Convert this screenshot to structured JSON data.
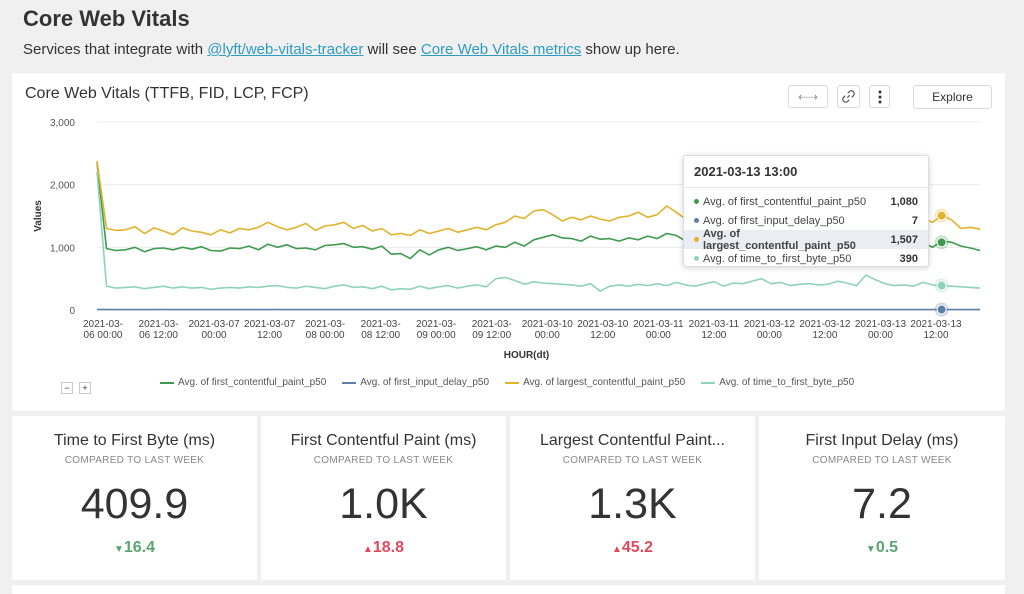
{
  "page": {
    "title": "Core Web Vitals",
    "subtitle_prefix": "Services that integrate with ",
    "subtitle_link1": "@lyft/web-vitals-tracker",
    "subtitle_middle": " will see ",
    "subtitle_link2": "Core Web Vitals metrics",
    "subtitle_suffix": " show up here."
  },
  "chart_card": {
    "title": "Core Web Vitals (TTFB, FID, LCP, FCP)",
    "explore_label": "Explore",
    "zoom_out": "−",
    "zoom_in": "+"
  },
  "tooltip": {
    "title": "2021-03-13 13:00",
    "rows": [
      {
        "name": "Avg. of first_contentful_paint_p50",
        "value": "1,080",
        "color": "#3d9a4f"
      },
      {
        "name": "Avg. of first_input_delay_p50",
        "value": "7",
        "color": "#5b7fa6"
      },
      {
        "name": "Avg. of largest_contentful_paint_p50",
        "value": "1,507",
        "color": "#e3b22b"
      },
      {
        "name": "Avg. of time_to_first_byte_p50",
        "value": "390",
        "color": "#8fd3b8"
      }
    ]
  },
  "chart_data": {
    "type": "line",
    "ylabel": "Values",
    "xlabel": "HOUR(dt)",
    "ylim": [
      0,
      3000
    ],
    "yticks": [
      "0",
      "1,000",
      "2,000",
      "3,000"
    ],
    "xticks": [
      [
        "2021-03-",
        "06 00:00"
      ],
      [
        "2021-03-",
        "06 12:00"
      ],
      [
        "2021-03-07",
        "00:00"
      ],
      [
        "2021-03-07",
        "12:00"
      ],
      [
        "2021-03-",
        "08 00:00"
      ],
      [
        "2021-03-",
        "08 12:00"
      ],
      [
        "2021-03-",
        "09 00:00"
      ],
      [
        "2021-03-",
        "09 12:00"
      ],
      [
        "2021-03-10",
        "00:00"
      ],
      [
        "2021-03-10",
        "12:00"
      ],
      [
        "2021-03-11",
        "00:00"
      ],
      [
        "2021-03-11",
        "12:00"
      ],
      [
        "2021-03-12",
        "00:00"
      ],
      [
        "2021-03-12",
        "12:00"
      ],
      [
        "2021-03-13",
        "00:00"
      ],
      [
        "2021-03-13",
        "12:00"
      ]
    ],
    "x_start": "2021-03-06 00:00",
    "x_step_hours": 3,
    "series": [
      {
        "name": "Avg. of first_contentful_paint_p50",
        "color": "#3d9a4f",
        "values": [
          2350,
          980,
          950,
          960,
          1000,
          930,
          980,
          990,
          960,
          1000,
          970,
          1010,
          950,
          940,
          990,
          980,
          1020,
          960,
          1050,
          1000,
          1040,
          980,
          990,
          960,
          1030,
          1040,
          1060,
          1000,
          1010,
          970,
          1020,
          890,
          900,
          820,
          960,
          880,
          960,
          1000,
          950,
          980,
          1010,
          960,
          1020,
          1000,
          1080,
          1020,
          1120,
          1160,
          1200,
          1150,
          1140,
          1100,
          1180,
          1130,
          1140,
          1100,
          1150,
          1120,
          1180,
          1140,
          1220,
          1190,
          1100,
          1160,
          1120,
          1140,
          1090,
          1160,
          1200,
          1220,
          1140,
          1080,
          1150,
          1100,
          1120,
          1150,
          1090,
          1100,
          1180,
          1110,
          1050,
          1080,
          1000,
          1060,
          1120,
          1080,
          1030,
          1080,
          1000,
          1100,
          1080,
          1020,
          990,
          950
        ]
      },
      {
        "name": "Avg. of first_input_delay_p50",
        "color": "#5b7fa6",
        "values": [
          10,
          7,
          6,
          7,
          7,
          6,
          7,
          8,
          7,
          6,
          7,
          7,
          7,
          7,
          6,
          7,
          7,
          7,
          7,
          8,
          7,
          6,
          7,
          7,
          7,
          7,
          7,
          7,
          6,
          7,
          7,
          7,
          7,
          7,
          7,
          6,
          7,
          7,
          7,
          7,
          7,
          7,
          7,
          7,
          7,
          6,
          7,
          7,
          7,
          7,
          7,
          7,
          7,
          7,
          7,
          7,
          6,
          7,
          7,
          7,
          7,
          7,
          7,
          7,
          7,
          7,
          7,
          7,
          7,
          7,
          6,
          7,
          7,
          7,
          7,
          7,
          7,
          7,
          7,
          7,
          7,
          7,
          7,
          7,
          7,
          6,
          7,
          7,
          7,
          7,
          7,
          7,
          7,
          7
        ]
      },
      {
        "name": "Avg. of largest_contentful_paint_p50",
        "color": "#e3b22b",
        "values": [
          2380,
          1300,
          1270,
          1280,
          1330,
          1220,
          1310,
          1260,
          1200,
          1310,
          1260,
          1240,
          1200,
          1280,
          1230,
          1300,
          1280,
          1320,
          1400,
          1330,
          1280,
          1320,
          1380,
          1270,
          1340,
          1360,
          1400,
          1300,
          1350,
          1260,
          1300,
          1200,
          1220,
          1190,
          1280,
          1220,
          1260,
          1300,
          1240,
          1280,
          1320,
          1280,
          1360,
          1400,
          1500,
          1460,
          1580,
          1600,
          1520,
          1420,
          1480,
          1440,
          1500,
          1450,
          1420,
          1480,
          1500,
          1560,
          1480,
          1520,
          1660,
          1560,
          1450,
          1540,
          1480,
          1500,
          1400,
          1470,
          1530,
          1560,
          1480,
          1420,
          1510,
          1440,
          1480,
          1500,
          1440,
          1460,
          1550,
          1480,
          1420,
          1450,
          1380,
          1400,
          1480,
          1440,
          1420,
          1460,
          1400,
          1510,
          1440,
          1300,
          1320,
          1290
        ]
      },
      {
        "name": "Avg. of time_to_first_byte_p50",
        "color": "#8fd3b8",
        "values": [
          2200,
          380,
          350,
          360,
          370,
          340,
          360,
          380,
          350,
          370,
          350,
          360,
          330,
          350,
          360,
          350,
          370,
          360,
          380,
          390,
          360,
          350,
          380,
          360,
          340,
          380,
          400,
          360,
          370,
          340,
          380,
          320,
          340,
          330,
          380,
          340,
          370,
          390,
          350,
          380,
          400,
          370,
          500,
          520,
          470,
          410,
          450,
          430,
          420,
          410,
          400,
          380,
          420,
          300,
          380,
          400,
          380,
          410,
          390,
          420,
          390,
          440,
          400,
          380,
          420,
          450,
          380,
          430,
          420,
          460,
          500,
          420,
          440,
          390,
          410,
          420,
          400,
          410,
          460,
          430,
          390,
          560,
          480,
          420,
          390,
          400,
          380,
          440,
          400,
          390,
          380,
          370,
          360,
          350
        ]
      }
    ],
    "highlight": {
      "label": "2021-03-13 13:00",
      "values": [
        1080,
        7,
        1507,
        390
      ]
    },
    "grid": true,
    "legend_position": "bottom"
  },
  "kpis": [
    {
      "title": "Time to First Byte (ms)",
      "subtitle": "COMPARED TO LAST WEEK",
      "value": "409.9",
      "delta": "16.4",
      "direction": "down",
      "arrow": "▼"
    },
    {
      "title": "First Contentful Paint (ms)",
      "subtitle": "COMPARED TO LAST WEEK",
      "value": "1.0K",
      "delta": "18.8",
      "direction": "up",
      "arrow": "▲"
    },
    {
      "title": "Largest Contentful Paint...",
      "subtitle": "COMPARED TO LAST WEEK",
      "value": "1.3K",
      "delta": "45.2",
      "direction": "up",
      "arrow": "▲"
    },
    {
      "title": "First Input Delay (ms)",
      "subtitle": "COMPARED TO LAST WEEK",
      "value": "7.2",
      "delta": "0.5",
      "direction": "down",
      "arrow": "▼"
    }
  ]
}
